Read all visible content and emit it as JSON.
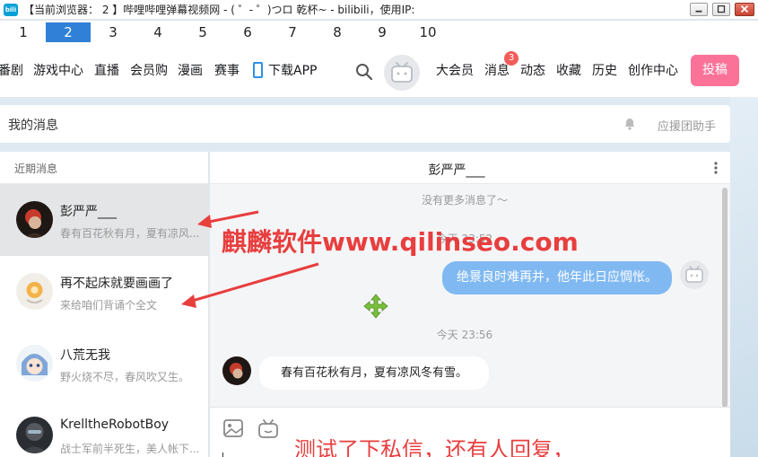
{
  "window": {
    "app_icon_text": "bili",
    "title": "【当前浏览器： 2 】哔哩哔哩弹幕视频网 - ( ゜- ゜)つロ 乾杯~ - bilibili，使用IP:"
  },
  "tabs": [
    {
      "label": "1"
    },
    {
      "label": "2",
      "active": true
    },
    {
      "label": "3"
    },
    {
      "label": "4"
    },
    {
      "label": "5"
    },
    {
      "label": "6"
    },
    {
      "label": "7"
    },
    {
      "label": "8"
    },
    {
      "label": "9"
    },
    {
      "label": "10"
    }
  ],
  "nav": {
    "left": [
      "番剧",
      "游戏中心",
      "直播",
      "会员购",
      "漫画",
      "赛事"
    ],
    "download": "下载APP",
    "right": [
      "大会员",
      "消息",
      "动态",
      "收藏",
      "历史",
      "创作中心"
    ],
    "message_badge": "3",
    "post_button": "投稿"
  },
  "messages_header": {
    "title": "我的消息",
    "helper": "应援团助手"
  },
  "sidebar": {
    "header": "近期消息",
    "conversations": [
      {
        "name": "彭严严___",
        "preview": "春有百花秋有月，夏有凉风..."
      },
      {
        "name": "再不起床就要画画了",
        "preview": "来给咱们背诵个全文"
      },
      {
        "name": "八荒无我",
        "preview": "野火烧不尽，春风吹又生。"
      },
      {
        "name": "KrelltheRobotBoy",
        "preview": "战士军前半死生，美人帐下..."
      }
    ]
  },
  "chat": {
    "title": "彭严严___",
    "no_more": "没有更多消息了～",
    "timestamp1": "今天 23:52",
    "my_message": "绝景良时难再并，他年此日应惆怅。",
    "timestamp2": "今天 23:56",
    "their_message": "春有百花秋有月，夏有凉风冬有雪。"
  },
  "overlay": {
    "watermark": "麒麟软件www.qilinseo.com",
    "note": "测试了下私信，还有人回复，"
  },
  "colors": {
    "brand_pink": "#fb7299",
    "active_tab": "#2f80d6",
    "my_bubble": "#80b9f2",
    "annotation_red": "#e83e3e"
  }
}
